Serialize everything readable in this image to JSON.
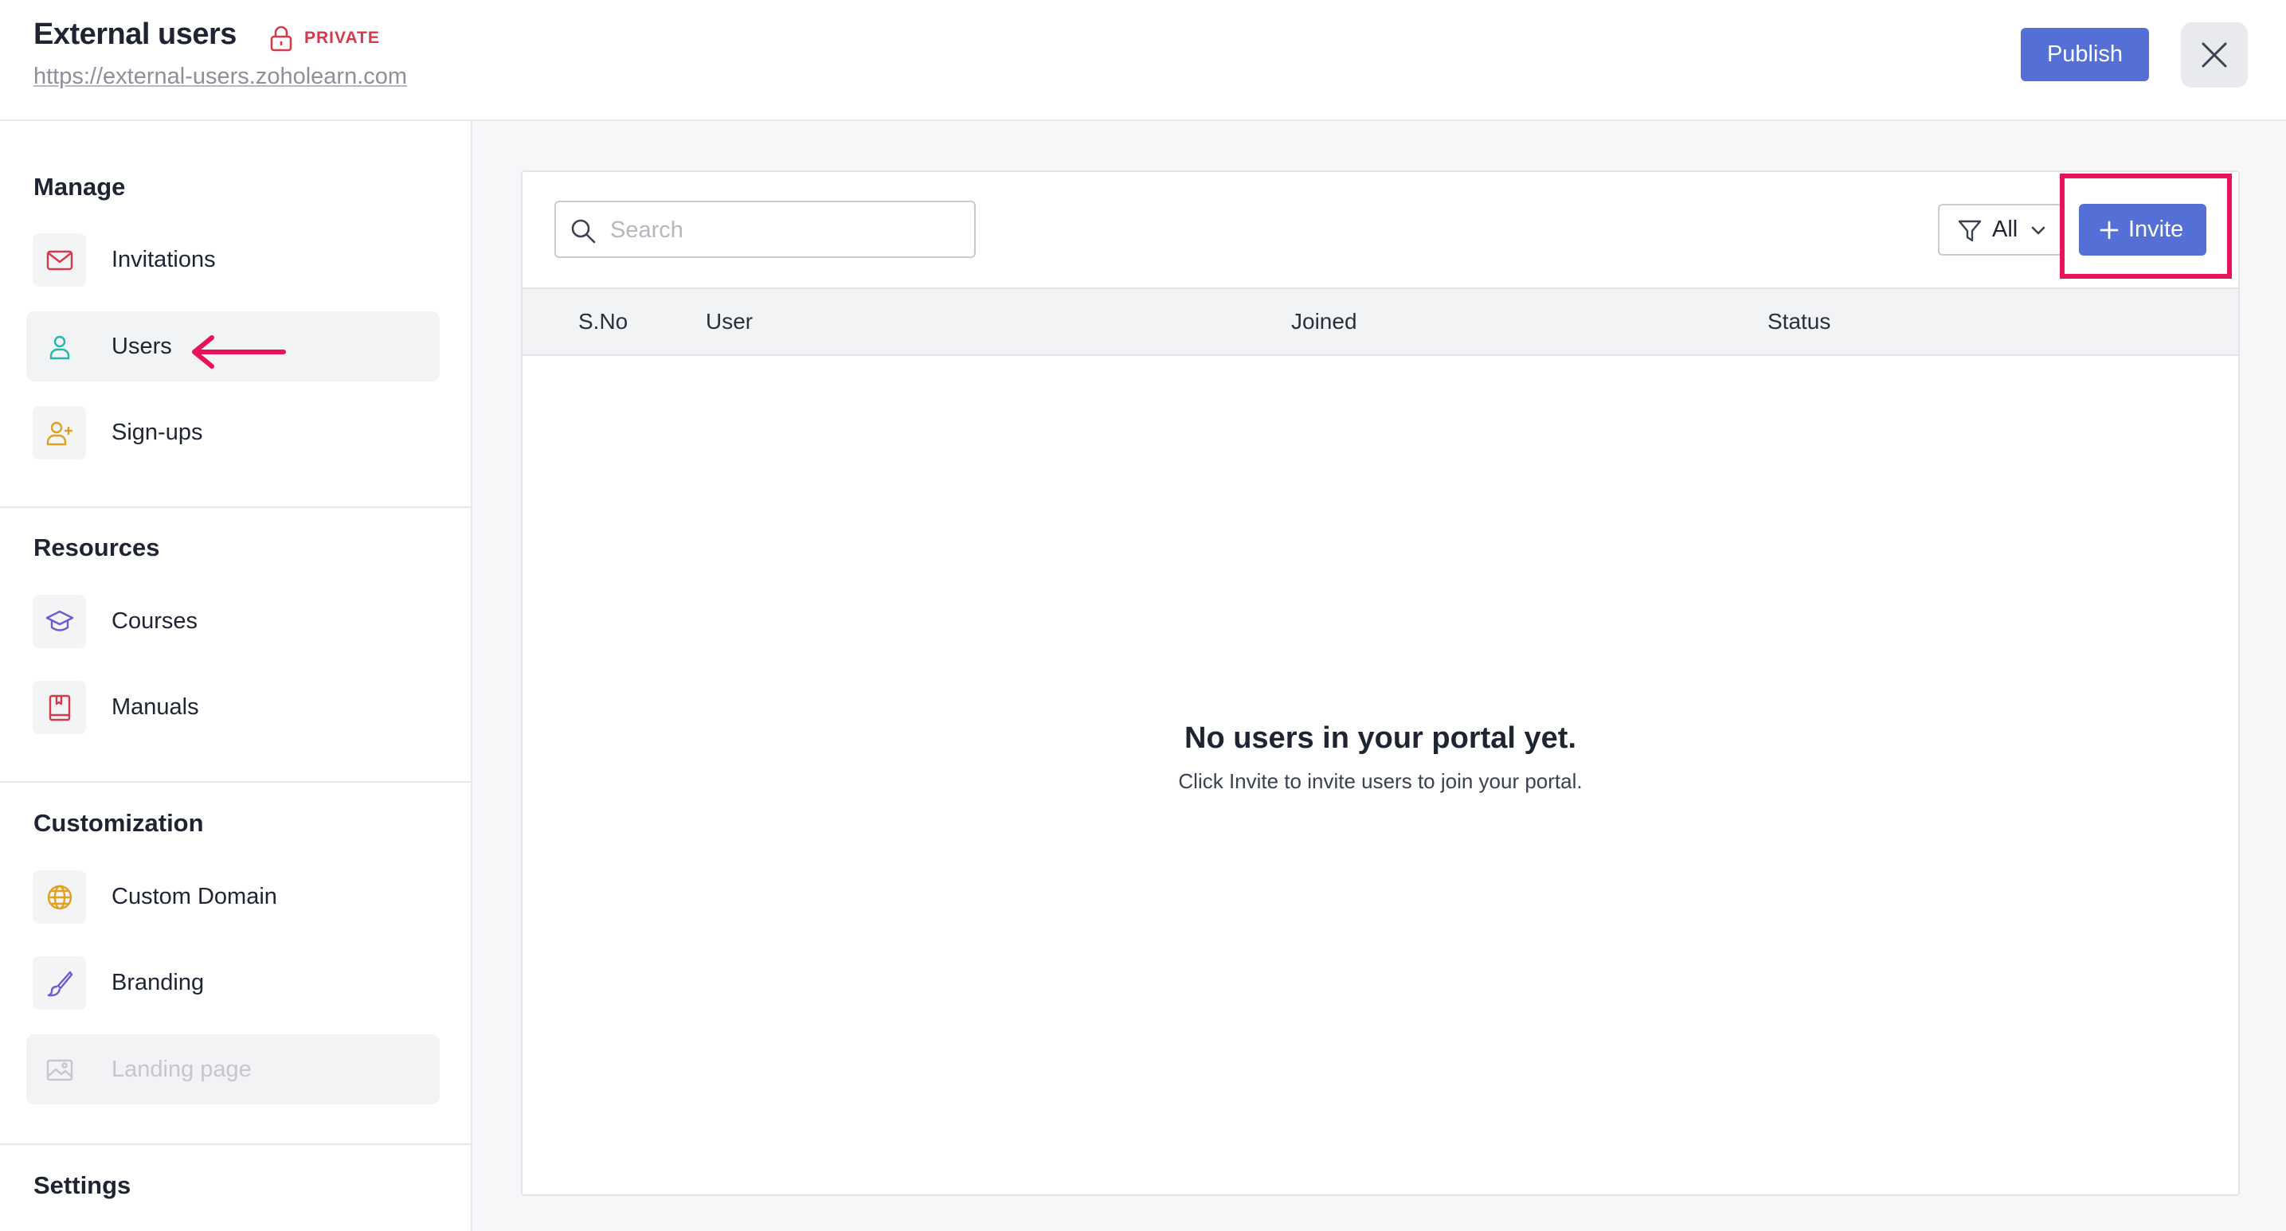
{
  "header": {
    "title": "External users",
    "privacy_label": "PRIVATE",
    "portal_url": "https://external-users.zoholearn.com",
    "publish_label": "Publish"
  },
  "sidebar": {
    "sections": [
      {
        "title": "Manage",
        "items": [
          {
            "label": "Invitations",
            "icon": "mail-icon"
          },
          {
            "label": "Users",
            "icon": "user-icon",
            "active": true
          },
          {
            "label": "Sign-ups",
            "icon": "user-plus-icon"
          }
        ]
      },
      {
        "title": "Resources",
        "items": [
          {
            "label": "Courses",
            "icon": "graduation-cap-icon"
          },
          {
            "label": "Manuals",
            "icon": "book-icon"
          }
        ]
      },
      {
        "title": "Customization",
        "items": [
          {
            "label": "Custom Domain",
            "icon": "globe-icon"
          },
          {
            "label": "Branding",
            "icon": "paintbrush-icon"
          },
          {
            "label": "Landing page",
            "icon": "image-icon",
            "disabled": true
          }
        ]
      },
      {
        "title": "Settings",
        "items": []
      }
    ]
  },
  "toolbar": {
    "search_placeholder": "Search",
    "search_value": "",
    "filter_label": "All",
    "invite_label": "Invite"
  },
  "table": {
    "columns": [
      "S.No",
      "User",
      "Joined",
      "Status"
    ],
    "rows": []
  },
  "empty_state": {
    "title": "No users in your portal yet.",
    "message": "Click Invite to invite users to join your portal."
  },
  "colors": {
    "primary": "#5470d6",
    "private_red": "#d63a4a",
    "annotation_pink": "#e8125a"
  }
}
